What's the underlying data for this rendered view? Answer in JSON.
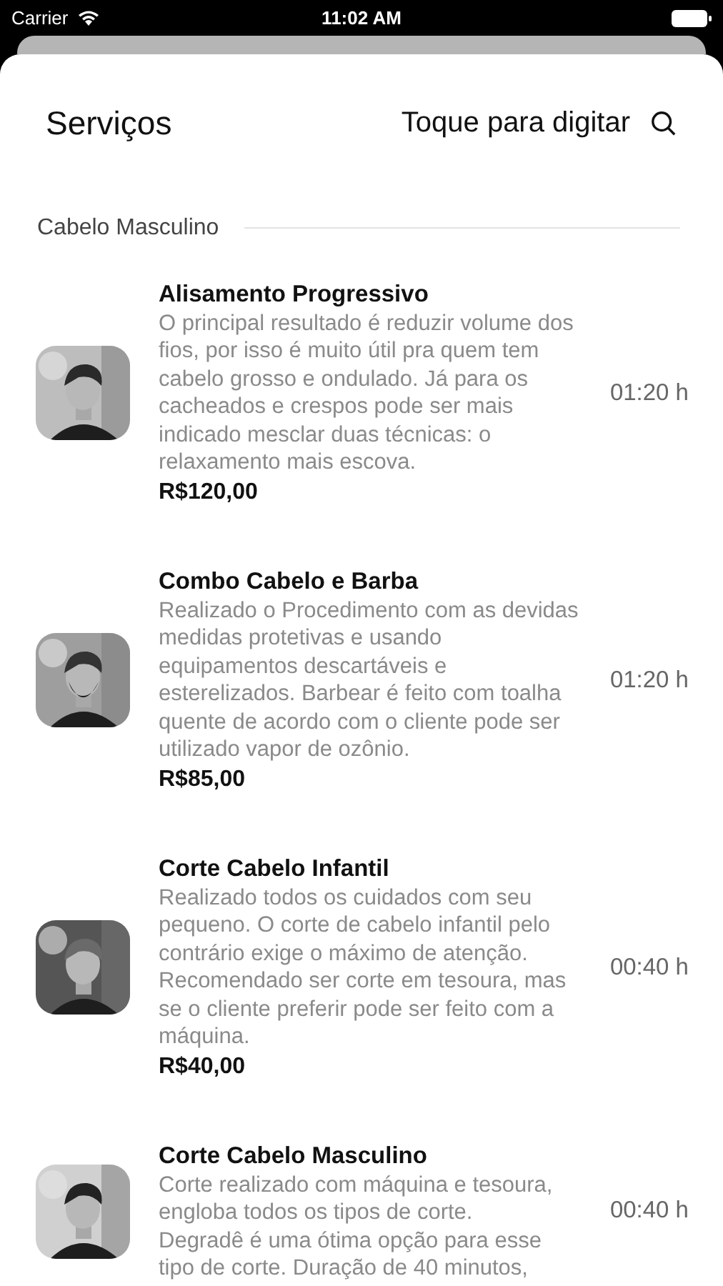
{
  "status_bar": {
    "carrier": "Carrier",
    "time": "11:02 AM"
  },
  "header": {
    "title": "Serviços",
    "search": {
      "placeholder": "Toque para digitar"
    }
  },
  "section": {
    "title": "Cabelo Masculino"
  },
  "services": [
    {
      "kind": "picture",
      "name": "Alisamento Progressivo",
      "description": "O principal resultado é reduzir volume dos fios, por isso é muito útil pra quem tem cabelo grosso e ondulado. Já para os cacheados e crespos pode ser mais indicado mesclar duas técnicas: o relaxamento mais escova.",
      "price": "R$120,00",
      "duration": "01:20 h"
    },
    {
      "kind": "picture",
      "name": "Combo Cabelo e Barba",
      "description": "Realizado o Procedimento com as devidas medidas protetivas e usando equipamentos descartáveis e esterelizados. Barbear é feito com toalha quente de acordo com o cliente pode ser utilizado vapor de ozônio.",
      "price": "R$85,00",
      "duration": "01:20 h"
    },
    {
      "kind": "picture",
      "name": "Corte Cabelo Infantil",
      "description": "Realizado todos os cuidados com seu pequeno. O corte de cabelo infantil pelo contrário exige o máximo de atenção. Recomendado ser corte em tesoura, mas se o cliente preferir pode ser feito com a máquina.",
      "price": "R$40,00",
      "duration": "00:40 h"
    },
    {
      "kind": "picture",
      "name": "Corte Cabelo Masculino",
      "description": "Corte realizado com máquina e tesoura, engloba todos os tipos de corte.\nDegradê é uma ótima opção para esse tipo de corte. Duração de 40 minutos,",
      "duration": "00:40 h"
    }
  ]
}
